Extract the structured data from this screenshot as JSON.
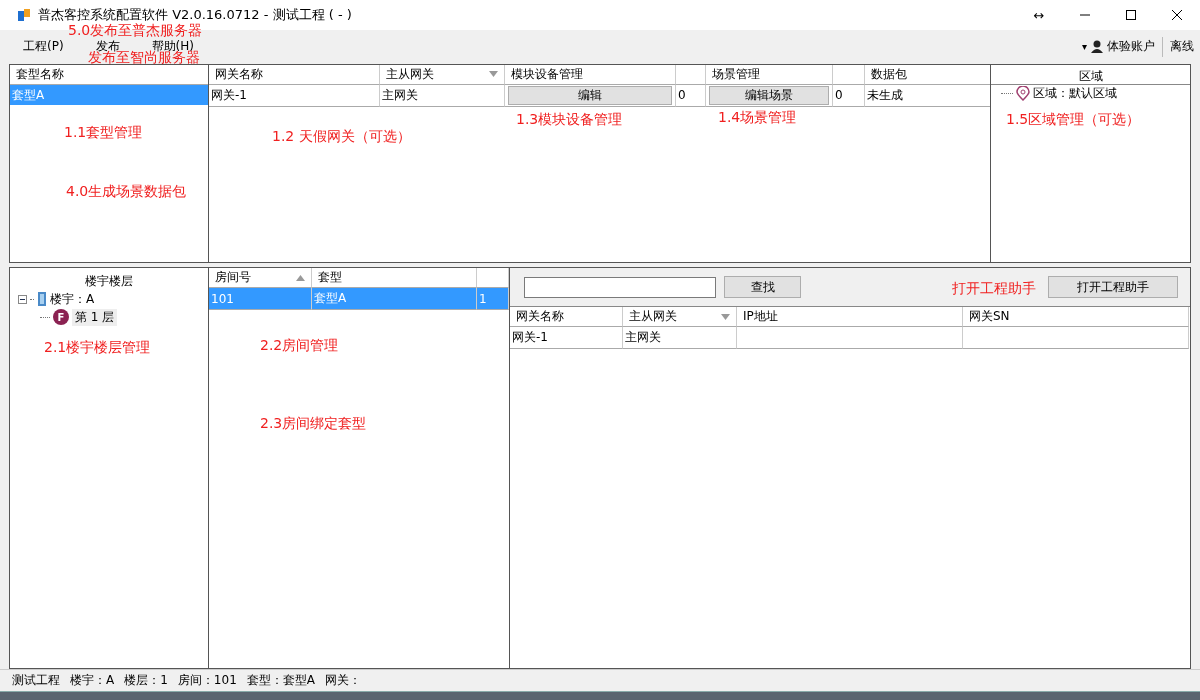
{
  "window": {
    "title": "普杰客控系统配置软件  V2.0.16.0712  -  测试工程 ( - )",
    "resize_glyph": "↔"
  },
  "menu": [
    {
      "label": "工程(P)"
    },
    {
      "label": "发布"
    },
    {
      "label": "帮助(H)"
    }
  ],
  "account": {
    "caret": "▾",
    "user": "体验账户",
    "status": "离线"
  },
  "suite_panel": {
    "header": "套型名称",
    "rows": [
      {
        "name": "套型A",
        "selected": true
      }
    ]
  },
  "gateway_table": {
    "columns": [
      "网关名称",
      "主从网关",
      "模块设备管理",
      null,
      "场景管理",
      null,
      "数据包"
    ],
    "rows": [
      {
        "name": "网关-1",
        "role": "主网关",
        "module_button": "编辑",
        "module_count": "0",
        "scene_button": "编辑场景",
        "scene_count": "0",
        "package": "未生成"
      }
    ]
  },
  "area_panel": {
    "header": "区域",
    "items": [
      {
        "label": "区域：默认区域"
      }
    ]
  },
  "building_panel": {
    "header": "楼宇楼层",
    "tree": [
      {
        "label": "楼宇：A",
        "expanded": true,
        "children": [
          {
            "label": "第 1 层",
            "badge": "F"
          }
        ]
      }
    ]
  },
  "room_table": {
    "columns": [
      "房间号",
      "套型"
    ],
    "rows": [
      {
        "room": "101",
        "suite": "套型A",
        "column_3": "1",
        "selected": true
      }
    ]
  },
  "search": {
    "button": "查找"
  },
  "assistant_button": "打开工程助手",
  "gateway_list": {
    "columns": [
      "网关名称",
      "主从网关",
      "IP地址",
      "网关SN"
    ],
    "rows": [
      {
        "cells": [
          "网关-1",
          "主网关",
          null,
          null
        ]
      }
    ]
  },
  "status_bar": [
    "测试工程",
    "楼宇：A",
    "楼层：1",
    "房间：101",
    "套型：套型A",
    "网关："
  ],
  "annotations": [
    "5.0发布至普杰服务器",
    "发布至智尚服务器",
    "1.1套型管理",
    "4.0生成场景数据包",
    "1.2 天假网关（可选）",
    "1.3模块设备管理",
    "1.4场景管理",
    "1.5区域管理（可选）",
    "2.1楼宇楼层管理",
    "2.2房间管理",
    "2.3房间绑定套型",
    "打开工程助手"
  ]
}
